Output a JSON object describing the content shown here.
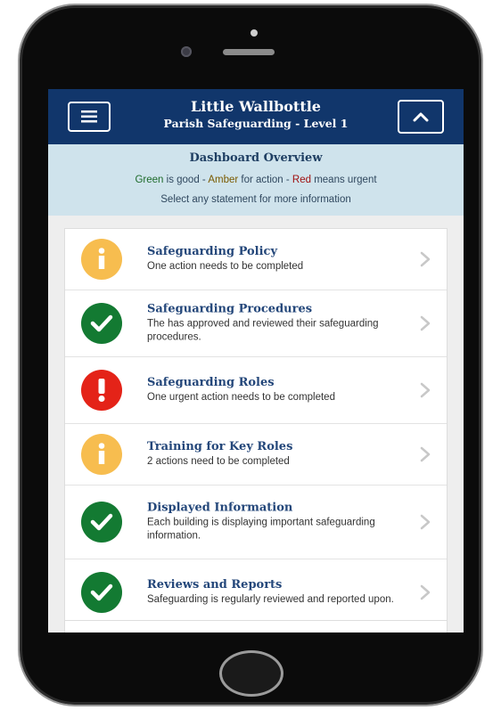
{
  "header": {
    "title": "Little Wallbottle",
    "subtitle": "Parish Safeguarding - Level 1"
  },
  "overview": {
    "title": "Dashboard Overview",
    "legend": {
      "green_word": "Green",
      "green_text": " is good - ",
      "amber_word": "Amber",
      "amber_text": " for action - ",
      "red_word": "Red",
      "red_text": " means urgent"
    },
    "instruction": "Select any statement for more information"
  },
  "items": [
    {
      "title": "Safeguarding Policy",
      "desc": "One action needs to be completed",
      "status": "amber"
    },
    {
      "title": "Safeguarding Procedures",
      "desc": "The has approved and reviewed their safeguarding procedures.",
      "status": "green"
    },
    {
      "title": "Safeguarding Roles",
      "desc": "One urgent action needs to be completed",
      "status": "red"
    },
    {
      "title": "Training for Key Roles",
      "desc": "2 actions need to be completed",
      "status": "amber"
    },
    {
      "title": "Displayed Information",
      "desc": "Each building is displaying important safeguarding information.",
      "status": "green"
    },
    {
      "title": "Reviews and Reports",
      "desc": "Safeguarding is regularly reviewed and reported upon.",
      "status": "green"
    }
  ],
  "colors": {
    "header_bg": "#11366b",
    "overview_bg": "#cfe3ec",
    "amber": "#f7bd4f",
    "green": "#137a32",
    "red": "#e42318",
    "title_text": "#24477a"
  },
  "icons": {
    "menu": "hamburger-icon",
    "collapse": "chevron-up-icon",
    "amber": "info-icon",
    "green": "check-icon",
    "red": "exclamation-icon",
    "row": "chevron-right-icon"
  }
}
